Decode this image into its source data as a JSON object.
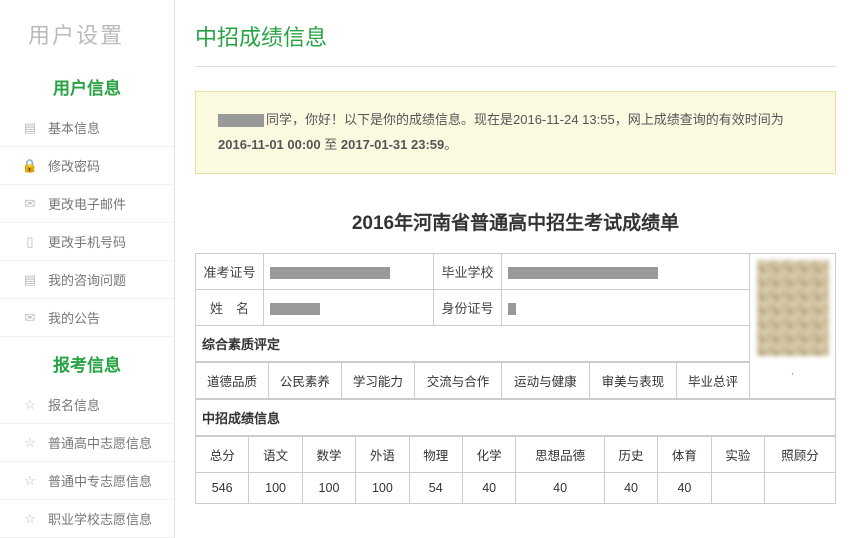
{
  "sidebar": {
    "title": "用户设置",
    "section1": "用户信息",
    "items1": [
      {
        "label": "基本信息"
      },
      {
        "label": "修改密码"
      },
      {
        "label": "更改电子邮件"
      },
      {
        "label": "更改手机号码"
      },
      {
        "label": "我的咨询问题"
      },
      {
        "label": "我的公告"
      }
    ],
    "section2": "报考信息",
    "items2": [
      {
        "label": "报名信息"
      },
      {
        "label": "普通高中志愿信息"
      },
      {
        "label": "普通中专志愿信息"
      },
      {
        "label": "职业学校志愿信息"
      }
    ]
  },
  "page": {
    "title": "中招成绩信息",
    "notice_pre": "同学，你好！以下是你的成绩信息。现在是",
    "notice_now": "2016-11-24 13:55",
    "notice_mid": "，网上成绩查询的有效时间为",
    "notice_start": "2016-11-01 00:00",
    "notice_to": " 至 ",
    "notice_end": "2017-01-31 23:59",
    "notice_period": "。"
  },
  "report": {
    "title": "2016年河南省普通高中招生考试成绩单",
    "fields": {
      "exam_no": "准考证号",
      "school": "毕业学校",
      "name": "姓　名",
      "idcard": "身份证号"
    },
    "quality_section": "综合素质评定",
    "quality_heads": [
      "道德品质",
      "公民素养",
      "学习能力",
      "交流与合作",
      "运动与健康",
      "审美与表现",
      "毕业总评"
    ],
    "score_section": "中招成绩信息",
    "score_heads": [
      "总分",
      "语文",
      "数学",
      "外语",
      "物理",
      "化学",
      "思想品德",
      "历史",
      "体育",
      "实验",
      "照顾分"
    ],
    "score_values": [
      "546",
      "100",
      "100",
      "100",
      "54",
      "40",
      "40",
      "40",
      "40",
      "",
      ""
    ]
  },
  "chart_data": {
    "type": "table",
    "title": "2016年河南省普通高中招生考试成绩单",
    "score_headers": [
      "总分",
      "语文",
      "数学",
      "外语",
      "物理",
      "化学",
      "思想品德",
      "历史",
      "体育",
      "实验",
      "照顾分"
    ],
    "score_values": [
      546,
      100,
      100,
      100,
      54,
      40,
      40,
      40,
      40,
      null,
      null
    ],
    "quality_headers": [
      "道德品质",
      "公民素养",
      "学习能力",
      "交流与合作",
      "运动与健康",
      "审美与表现",
      "毕业总评"
    ]
  }
}
